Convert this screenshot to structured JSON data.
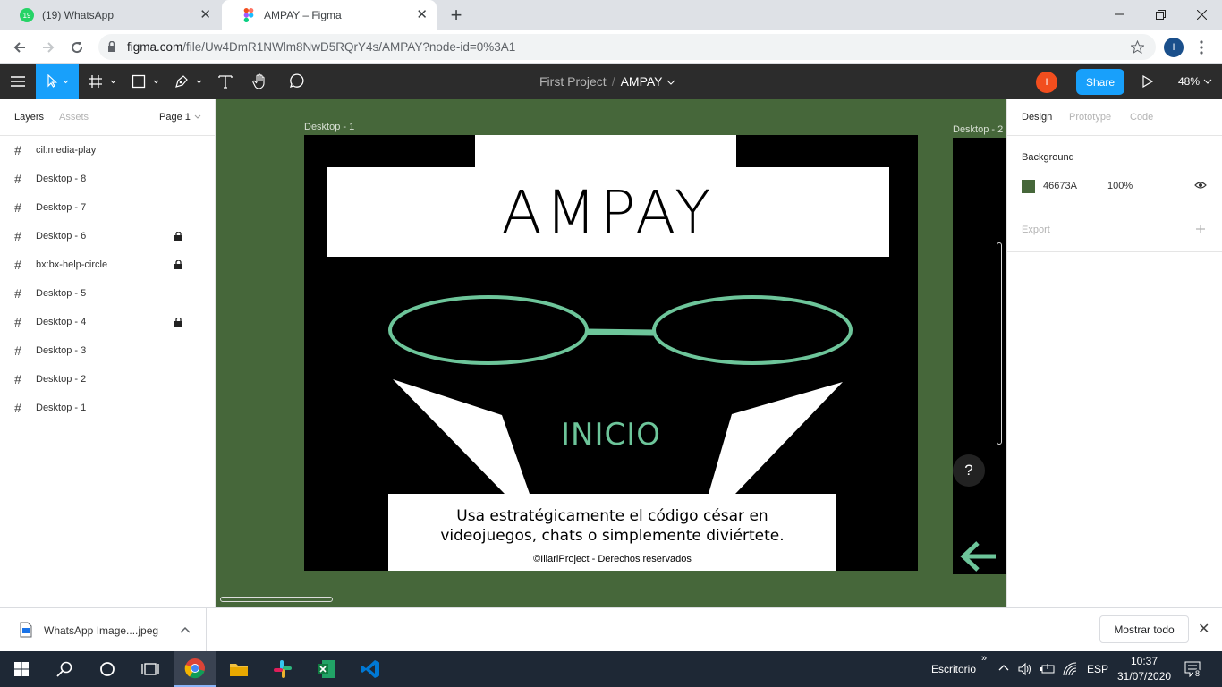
{
  "browser": {
    "tabs": [
      {
        "title": "(19) WhatsApp",
        "badge": "19",
        "active": false
      },
      {
        "title": "AMPAY – Figma",
        "active": true
      }
    ],
    "url_host": "figma.com",
    "url_rest": "/file/Uw4DmR1NWlm8NwD5RQrY4s/AMPAY?node-id=0%3A1",
    "profile_initial": "I"
  },
  "figma": {
    "breadcrumb_project": "First Project",
    "breadcrumb_sep": "/",
    "doc_title": "AMPAY",
    "user_initial": "I",
    "share_label": "Share",
    "zoom": "48%",
    "left_tabs": {
      "layers": "Layers",
      "assets": "Assets",
      "page": "Page 1"
    },
    "layers": [
      {
        "name": "cil:media-play",
        "locked": false
      },
      {
        "name": "Desktop - 8",
        "locked": false
      },
      {
        "name": "Desktop - 7",
        "locked": false
      },
      {
        "name": "Desktop - 6",
        "locked": true
      },
      {
        "name": "bx:bx-help-circle",
        "locked": true
      },
      {
        "name": "Desktop - 5",
        "locked": false
      },
      {
        "name": "Desktop - 4",
        "locked": true
      },
      {
        "name": "Desktop - 3",
        "locked": false
      },
      {
        "name": "Desktop - 2",
        "locked": false
      },
      {
        "name": "Desktop - 1",
        "locked": false
      }
    ],
    "right_tabs": {
      "design": "Design",
      "prototype": "Prototype",
      "code": "Code"
    },
    "background_label": "Background",
    "background_hex": "46673A",
    "background_opacity": "100%",
    "export_label": "Export",
    "canvas_color": "#46673a",
    "accent_color": "#18a0fb"
  },
  "frames": {
    "frame1_label": "Desktop - 1",
    "frame2_label": "Desktop - 2",
    "title": "AMPAY",
    "inicio": "INICIO",
    "desc_line1": "Usa estratégicamente el código césar en",
    "desc_line2": "videojuegos, chats  o simplemente diviértete.",
    "copyright": "©IllariProject - Derechos reservados",
    "accent_green": "#6dc59a"
  },
  "help_label": "?",
  "downloads": {
    "file_name": "WhatsApp Image....jpeg",
    "show_all": "Mostrar todo"
  },
  "taskbar": {
    "desktop_label": "Escritorio",
    "language": "ESP",
    "time": "10:37",
    "date": "31/07/2020",
    "notifications": "8"
  }
}
